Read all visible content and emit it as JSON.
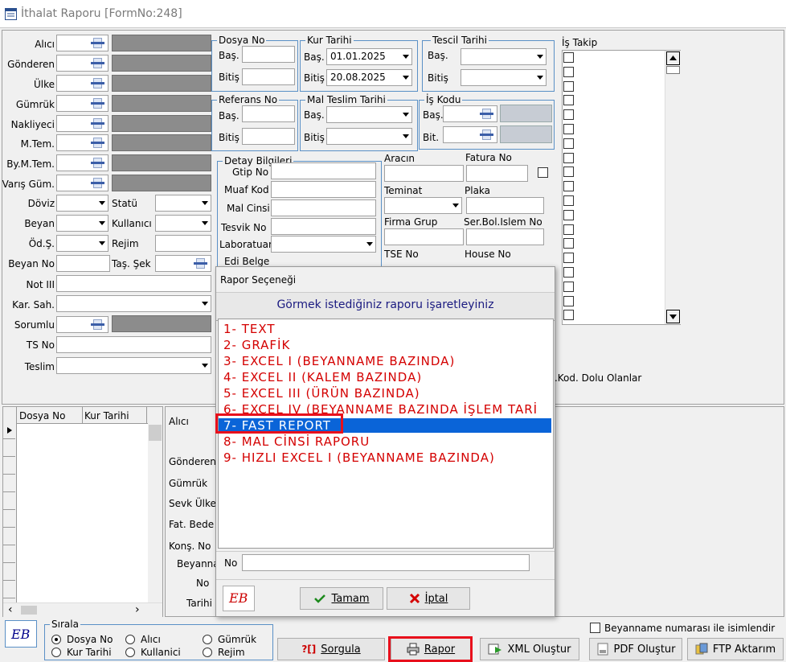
{
  "window": {
    "title": "İthalat Raporu [FormNo:248]"
  },
  "left_labels": [
    "Alıcı",
    "Gönderen",
    "Ülke",
    "Gümrük",
    "Nakliyeci",
    "M.Tem.",
    "By.M.Tem.",
    "Varış Güm.",
    "Döviz",
    "Beyan",
    "Öd.Ş.",
    "Beyan No",
    "Not III",
    "Kar. Sah.",
    "Sorumlu",
    "TS No",
    "Teslim"
  ],
  "mid_labels": {
    "statu": "Statü",
    "kullanici": "Kullanıcı",
    "rejim": "Rejim",
    "tas_sek": "Taş. Şek"
  },
  "dosya_no": {
    "legend": "Dosya No",
    "bas": "Baş.",
    "bitis": "Bitiş"
  },
  "kur_tarihi": {
    "legend": "Kur Tarihi",
    "bas": "Baş.",
    "bitis": "Bitiş",
    "bas_value": "01.01.2025",
    "bitis_value": "20.08.2025"
  },
  "tescil_tarihi": {
    "legend": "Tescil Tarihi",
    "bas": "Baş.",
    "bitis": "Bitiş"
  },
  "referans_no": {
    "legend": "Referans No",
    "bas": "Baş.",
    "bitis": "Bitiş"
  },
  "mal_teslim": {
    "legend": "Mal Teslim Tarihi",
    "bas": "Baş.",
    "bitis": "Bitiş"
  },
  "is_kodu": {
    "legend": "İş Kodu",
    "bas": "Baş.",
    "bit": "Bit."
  },
  "is_takip": {
    "label": "İş Takip"
  },
  "detay": {
    "legend": "Detay Bilgileri",
    "gtip": "Gtip No",
    "muaf": "Muaf Kod",
    "mal_cinsi": "Mal Cinsi",
    "tesvik": "Tesvik No",
    "laboratuar": "Laboratuar",
    "edi": "Edi Belge"
  },
  "right_fields": {
    "aracin": "Aracın",
    "fatura_no": "Fatura No",
    "teminat": "Teminat",
    "plaka": "Plaka",
    "firma_grup": "Firma Grup",
    "ser_bol": "Ser.Bol.Islem No",
    "tse_no": "TSE No",
    "house_no": "House No"
  },
  "kod_dolu": "k.Kod. Dolu Olanlar",
  "grid": {
    "col1": "Dosya No",
    "col2": "Kur Tarihi"
  },
  "detail_labels": [
    "Alıcı",
    "Gönderen",
    "Gümrük",
    "Sevk Ülke",
    "Fat. Bede",
    "Konş. No",
    "Beyanna",
    "No",
    "Tarihi"
  ],
  "dialog": {
    "title": "Rapor Seçeneği",
    "header": "Görmek istediğiniz raporu işaretleyiniz",
    "items": [
      "1- TEXT",
      "2- GRAFİK",
      "3- EXCEL I (BEYANNAME BAZINDA)",
      "4- EXCEL II (KALEM BAZINDA)",
      "5- EXCEL III (ÜRÜN BAZINDA)",
      "6- EXCEL IV (BEYANNAME BAZINDA İŞLEM TARİ",
      "7- FAST REPORT",
      "8- MAL CİNSİ RAPORU",
      "9- HIZLI EXCEL I (BEYANNAME BAZINDA)"
    ],
    "selected_index": 6,
    "no_label": "No",
    "ok": "Tamam",
    "cancel": "İptal"
  },
  "sirala": {
    "legend": "Sırala",
    "options": [
      "Dosya No",
      "Alıcı",
      "Gümrük",
      "Kur Tarihi",
      "Kullanici",
      "Rejim"
    ],
    "selected": "Dosya No"
  },
  "beyan_chk": "Beyanname numarası ile isimlendir",
  "buttons": {
    "sorgula": "Sorgula",
    "rapor": "Rapor",
    "xml": "XML Oluştur",
    "pdf": "PDF Oluştur",
    "ftp": "FTP Aktarım"
  },
  "logo": "EB",
  "colors": {
    "accent": "#0a64d8",
    "list_text": "#d40000",
    "highlight": "#e8101c",
    "header_text": "#1a1a80"
  }
}
